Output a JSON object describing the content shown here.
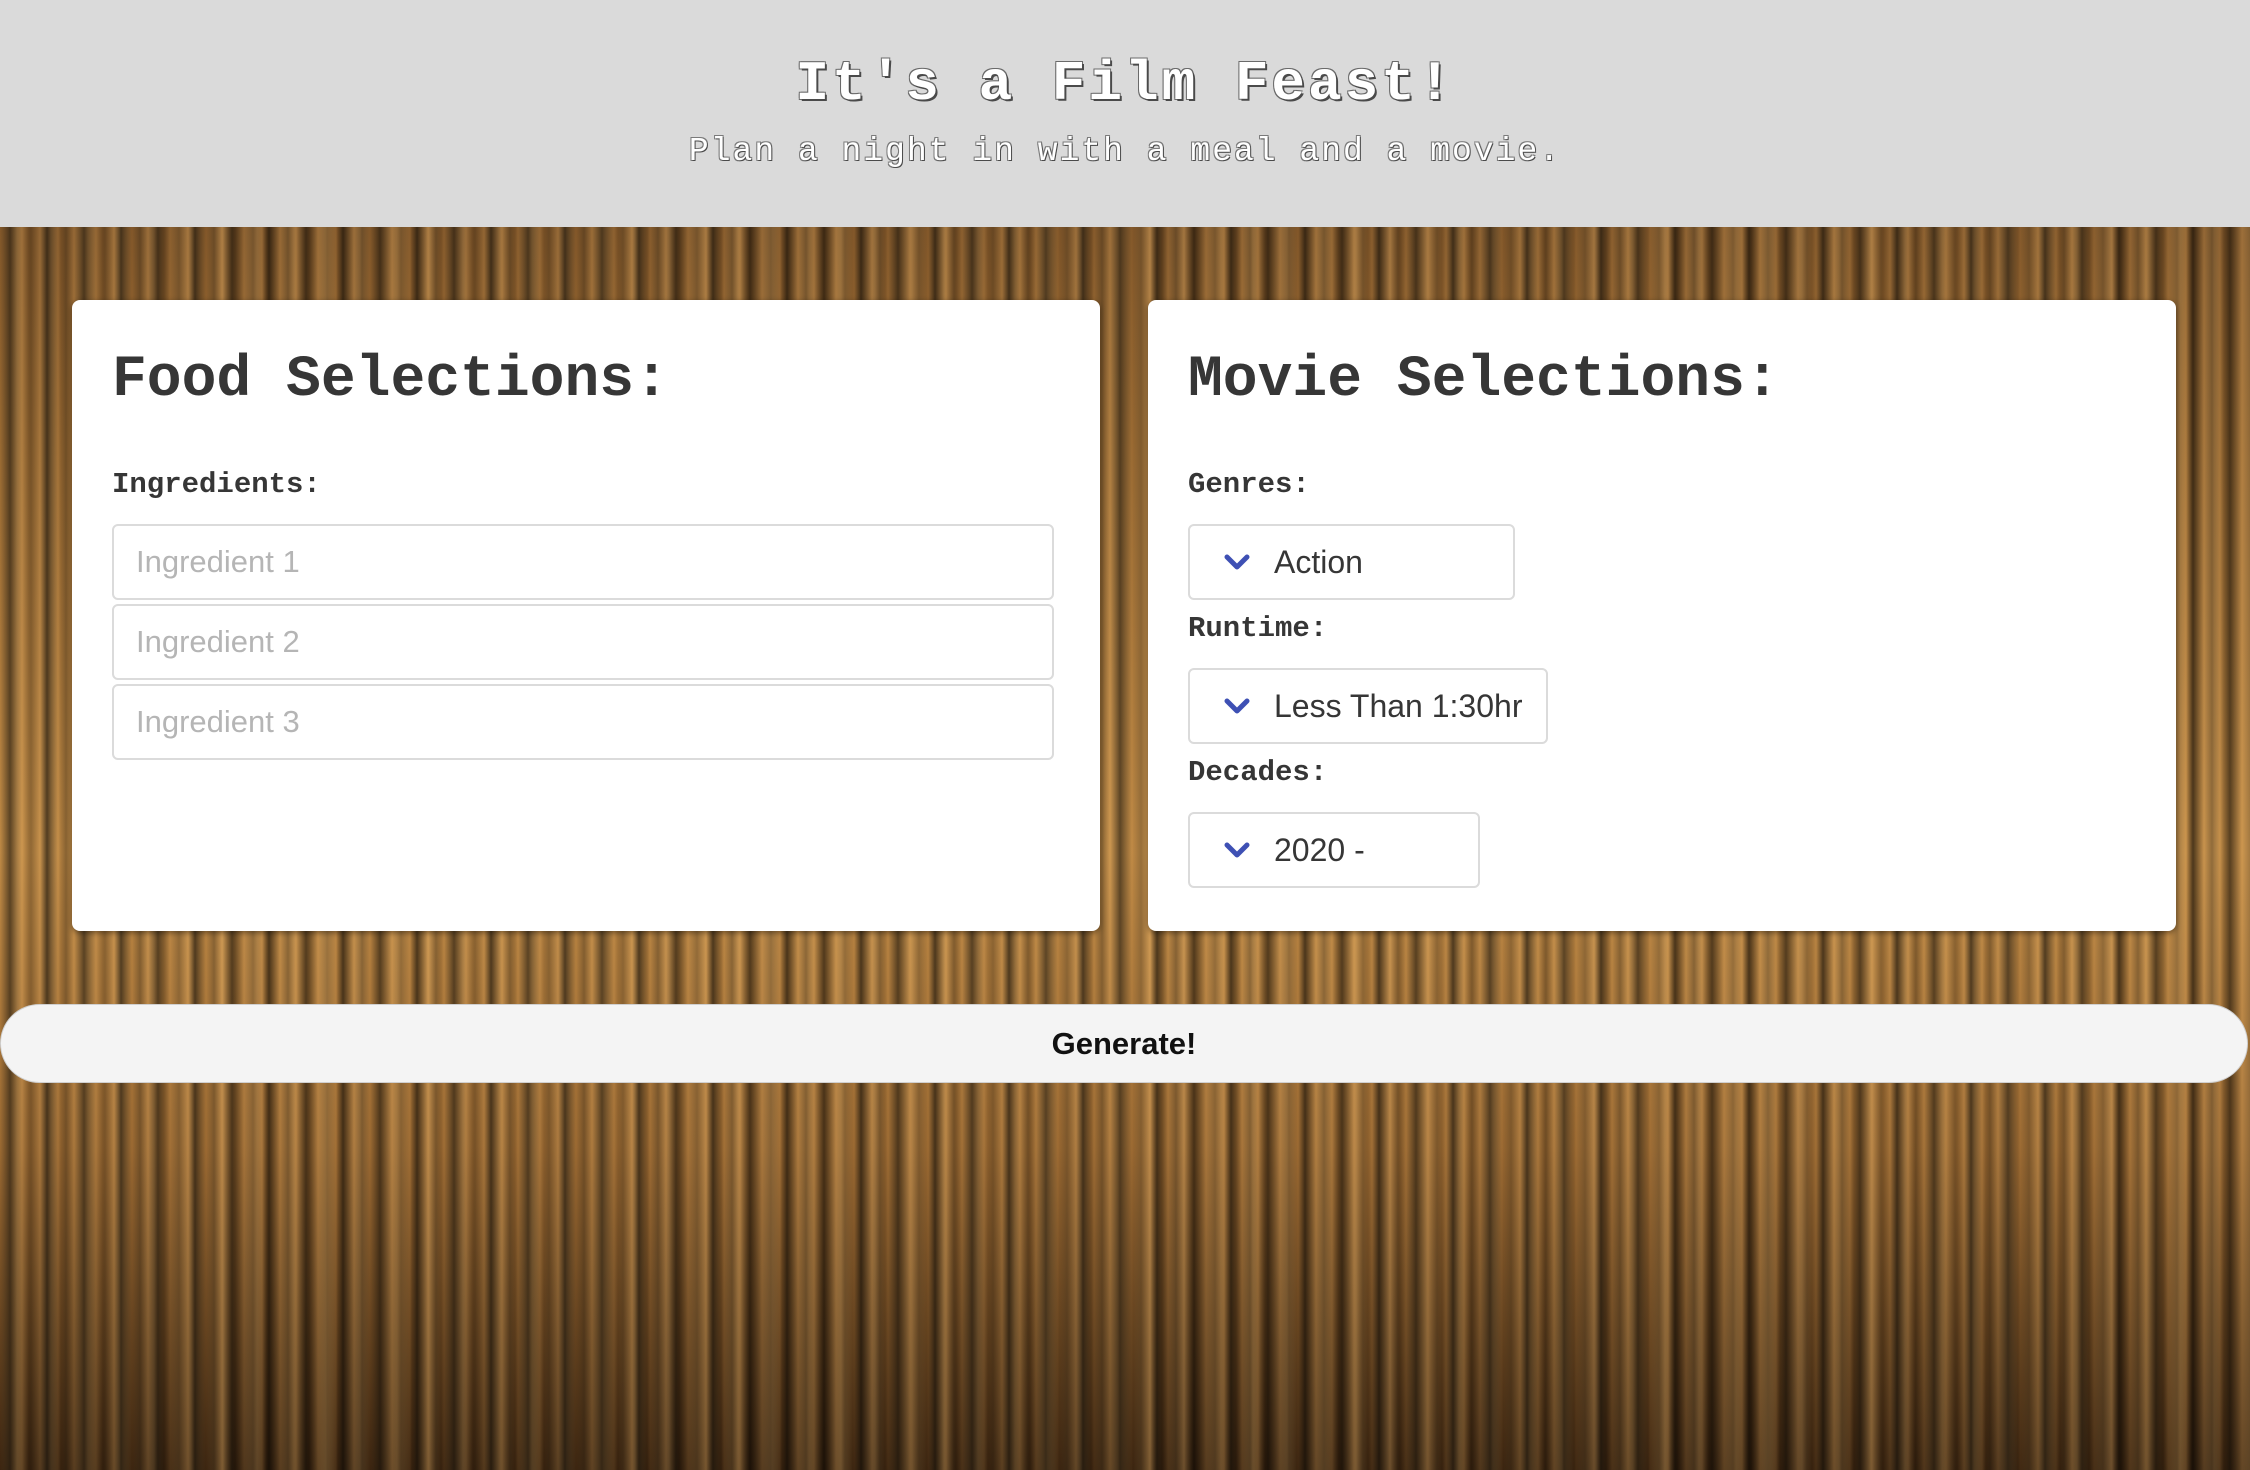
{
  "header": {
    "title": "It's a Film Feast!",
    "subtitle": "Plan a night in with a meal and a movie."
  },
  "food": {
    "title": "Food Selections:",
    "ingredients_label": "Ingredients:",
    "inputs": [
      {
        "placeholder": "Ingredient 1",
        "value": ""
      },
      {
        "placeholder": "Ingredient 2",
        "value": ""
      },
      {
        "placeholder": "Ingredient 3",
        "value": ""
      }
    ]
  },
  "movie": {
    "title": "Movie Selections:",
    "genres_label": "Genres:",
    "genre_selected": "Action",
    "runtime_label": "Runtime:",
    "runtime_selected": "Less Than 1:30hr",
    "decades_label": "Decades:",
    "decade_selected": "2020 -"
  },
  "generate_label": "Generate!",
  "colors": {
    "header_bg": "#dadada",
    "chevron": "#3e50b4",
    "card_bg": "#ffffff",
    "button_bg": "#f4f4f4"
  },
  "icons": {
    "select_arrow": "chevron-down-icon"
  }
}
